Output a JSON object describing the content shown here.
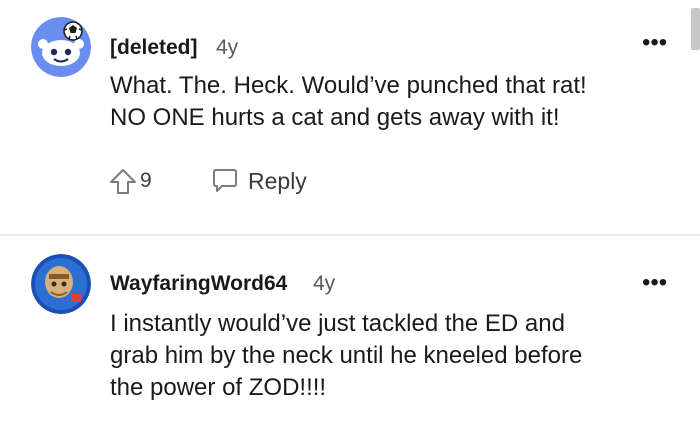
{
  "comments": [
    {
      "author": "[deleted]",
      "age": "4y",
      "body_lines": [
        "What. The. Heck. Would’ve punched that rat!",
        "NO ONE hurts a cat and gets away with it!"
      ],
      "votes": "9",
      "reply_label": "Reply",
      "more_label": "•••"
    },
    {
      "author": "WayfaringWord64",
      "age": "4y",
      "body_lines": [
        "I instantly would’ve just tackled the ED and",
        "grab him by the neck until he kneeled before",
        "the power of ZOD!!!!"
      ],
      "more_label": "•••"
    }
  ],
  "colors": {
    "avatar_snoo_bg": "#6a8ef0",
    "avatar_user_bg": "#1b4fb3",
    "divider": "#e9e9ea"
  },
  "icons": [
    "snoo-avatar-icon",
    "user-avatar-icon",
    "more-options-icon",
    "upvote-icon",
    "reply-bubble-icon"
  ]
}
